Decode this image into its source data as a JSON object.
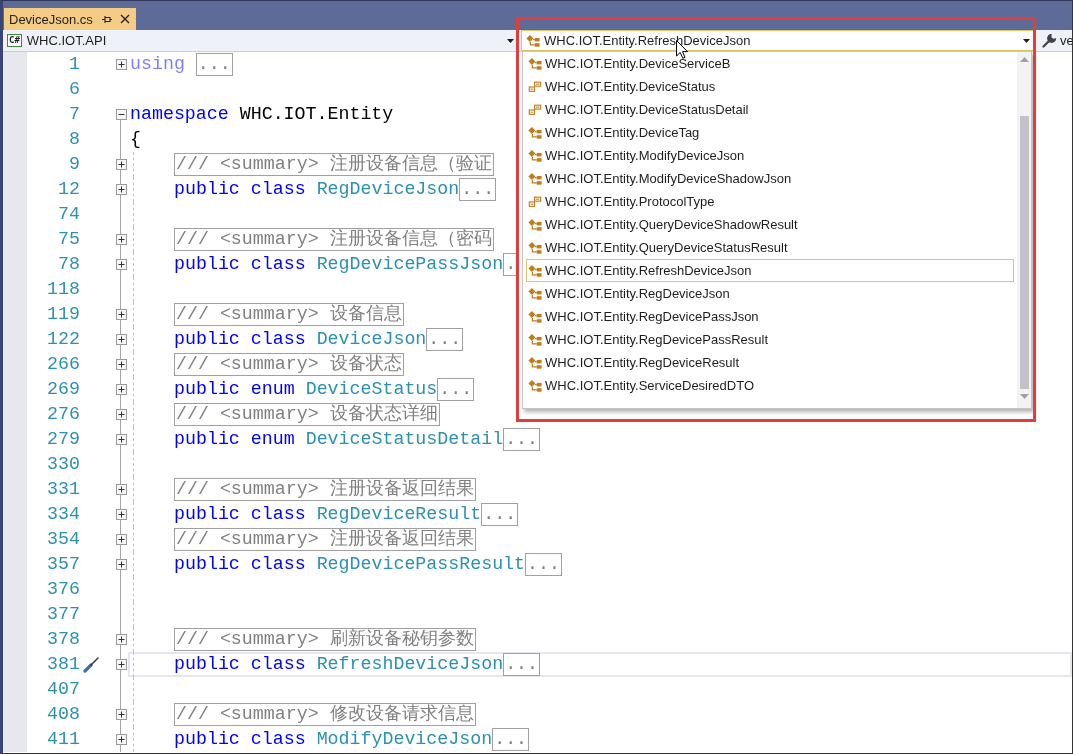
{
  "tabs": [
    {
      "label": "DeviceJson.cs",
      "selected": true
    }
  ],
  "navigation_bar": {
    "project_badge": "C#",
    "project": "WHC.IOT.API",
    "type_selector": {
      "value": "WHC.IOT.Entity.RefreshDeviceJson",
      "kind": "class",
      "expanded": true,
      "items": [
        {
          "label": "WHC.IOT.Entity.DeviceServiceB",
          "kind": "class",
          "selected": false
        },
        {
          "label": "WHC.IOT.Entity.DeviceStatus",
          "kind": "enum",
          "selected": false
        },
        {
          "label": "WHC.IOT.Entity.DeviceStatusDetail",
          "kind": "enum",
          "selected": false
        },
        {
          "label": "WHC.IOT.Entity.DeviceTag",
          "kind": "class",
          "selected": false
        },
        {
          "label": "WHC.IOT.Entity.ModifyDeviceJson",
          "kind": "class",
          "selected": false
        },
        {
          "label": "WHC.IOT.Entity.ModifyDeviceShadowJson",
          "kind": "class",
          "selected": false
        },
        {
          "label": "WHC.IOT.Entity.ProtocolType",
          "kind": "enum",
          "selected": false
        },
        {
          "label": "WHC.IOT.Entity.QueryDeviceShadowResult",
          "kind": "class",
          "selected": false
        },
        {
          "label": "WHC.IOT.Entity.QueryDeviceStatusResult",
          "kind": "class",
          "selected": false
        },
        {
          "label": "WHC.IOT.Entity.RefreshDeviceJson",
          "kind": "class",
          "selected": true
        },
        {
          "label": "WHC.IOT.Entity.RegDeviceJson",
          "kind": "class",
          "selected": false
        },
        {
          "label": "WHC.IOT.Entity.RegDevicePassJson",
          "kind": "class",
          "selected": false
        },
        {
          "label": "WHC.IOT.Entity.RegDevicePassResult",
          "kind": "class",
          "selected": false
        },
        {
          "label": "WHC.IOT.Entity.RegDeviceResult",
          "kind": "class",
          "selected": false
        },
        {
          "label": "WHC.IOT.Entity.ServiceDesiredDTO",
          "kind": "class",
          "selected": false
        }
      ]
    },
    "member_selector": "ve"
  },
  "editor": {
    "lines": [
      {
        "number": "1",
        "folded": true,
        "current": false,
        "tokens": [
          {
            "kind": "directive",
            "text": "using"
          },
          {
            "kind": "fold",
            "text": "..."
          }
        ]
      },
      {
        "number": "6",
        "current": false
      },
      {
        "number": "7",
        "folded": false,
        "current": false,
        "tokens": [
          {
            "kind": "keyword",
            "text": "namespace"
          },
          {
            "kind": "plain",
            "text": "WHC.IOT.Entity"
          }
        ]
      },
      {
        "number": "8",
        "current": false,
        "tokens": [
          {
            "kind": "plain",
            "text": "{"
          }
        ],
        "children": [
          {
            "number": "9",
            "folded": true,
            "current": false,
            "tokens": [
              {
                "kind": "comment",
                "text": "/// <summary> 注册设备信息（验证"
              }
            ]
          },
          {
            "number": "12",
            "folded": true,
            "current": false,
            "tokens": [
              {
                "kind": "keyword",
                "text": "public"
              },
              {
                "kind": "keyword",
                "text": "class"
              },
              {
                "kind": "type",
                "text": "RegDeviceJson"
              },
              {
                "kind": "fold",
                "text": "..."
              }
            ]
          },
          {
            "number": "74",
            "current": false
          },
          {
            "number": "75",
            "folded": true,
            "current": false,
            "tokens": [
              {
                "kind": "comment",
                "text": "/// <summary> 注册设备信息（密码"
              }
            ]
          },
          {
            "number": "78",
            "folded": true,
            "current": false,
            "tokens": [
              {
                "kind": "keyword",
                "text": "public"
              },
              {
                "kind": "keyword",
                "text": "class"
              },
              {
                "kind": "type",
                "text": "RegDevicePassJson"
              },
              {
                "kind": "fold",
                "text": "."
              }
            ]
          },
          {
            "number": "118",
            "current": false
          },
          {
            "number": "119",
            "folded": true,
            "current": false,
            "tokens": [
              {
                "kind": "comment",
                "text": "/// <summary> 设备信息"
              }
            ]
          },
          {
            "number": "122",
            "folded": true,
            "current": false,
            "tokens": [
              {
                "kind": "keyword",
                "text": "public"
              },
              {
                "kind": "keyword",
                "text": "class"
              },
              {
                "kind": "type",
                "text": "DeviceJson"
              },
              {
                "kind": "fold",
                "text": "..."
              }
            ]
          },
          {
            "number": "266",
            "folded": true,
            "current": false,
            "tokens": [
              {
                "kind": "comment",
                "text": "/// <summary> 设备状态"
              }
            ]
          },
          {
            "number": "269",
            "folded": true,
            "current": false,
            "tokens": [
              {
                "kind": "keyword",
                "text": "public"
              },
              {
                "kind": "keyword",
                "text": "enum"
              },
              {
                "kind": "type",
                "text": "DeviceStatus"
              },
              {
                "kind": "fold",
                "text": "..."
              }
            ]
          },
          {
            "number": "276",
            "folded": true,
            "current": false,
            "tokens": [
              {
                "kind": "comment",
                "text": "/// <summary> 设备状态详细"
              }
            ]
          },
          {
            "number": "279",
            "folded": true,
            "current": false,
            "tokens": [
              {
                "kind": "keyword",
                "text": "public"
              },
              {
                "kind": "keyword",
                "text": "enum"
              },
              {
                "kind": "type",
                "text": "DeviceStatusDetail"
              },
              {
                "kind": "fold",
                "text": "..."
              }
            ]
          },
          {
            "number": "330",
            "current": false
          },
          {
            "number": "331",
            "folded": true,
            "current": false,
            "tokens": [
              {
                "kind": "comment",
                "text": "/// <summary> 注册设备返回结果"
              }
            ]
          },
          {
            "number": "334",
            "folded": true,
            "current": false,
            "tokens": [
              {
                "kind": "keyword",
                "text": "public"
              },
              {
                "kind": "keyword",
                "text": "class"
              },
              {
                "kind": "type",
                "text": "RegDeviceResult"
              },
              {
                "kind": "fold",
                "text": "..."
              }
            ]
          },
          {
            "number": "354",
            "folded": true,
            "current": false,
            "tokens": [
              {
                "kind": "comment",
                "text": "/// <summary> 注册设备返回结果"
              }
            ]
          },
          {
            "number": "357",
            "folded": true,
            "current": false,
            "tokens": [
              {
                "kind": "keyword",
                "text": "public"
              },
              {
                "kind": "keyword",
                "text": "class"
              },
              {
                "kind": "type",
                "text": "RegDevicePassResult"
              },
              {
                "kind": "fold",
                "text": "..."
              }
            ]
          },
          {
            "number": "376",
            "current": false
          },
          {
            "number": "377",
            "current": false
          },
          {
            "number": "378",
            "folded": true,
            "current": false,
            "tokens": [
              {
                "kind": "comment",
                "text": "/// <summary> 刷新设备秘钥参数"
              }
            ]
          },
          {
            "number": "381",
            "folded": true,
            "current": true,
            "quick_actions": true,
            "tokens": [
              {
                "kind": "keyword",
                "text": "public"
              },
              {
                "kind": "keyword",
                "text": "class"
              },
              {
                "kind": "type",
                "text": "RefreshDeviceJson"
              },
              {
                "kind": "fold",
                "text": "..."
              }
            ]
          },
          {
            "number": "407",
            "current": false
          },
          {
            "number": "408",
            "folded": true,
            "current": false,
            "tokens": [
              {
                "kind": "comment",
                "text": "/// <summary> 修改设备请求信息"
              }
            ]
          },
          {
            "number": "411",
            "folded": true,
            "current": false,
            "tokens": [
              {
                "kind": "keyword",
                "text": "public"
              },
              {
                "kind": "keyword",
                "text": "class"
              },
              {
                "kind": "type",
                "text": "ModifyDeviceJson"
              },
              {
                "kind": "fold",
                "text": "..."
              }
            ]
          }
        ]
      }
    ]
  }
}
